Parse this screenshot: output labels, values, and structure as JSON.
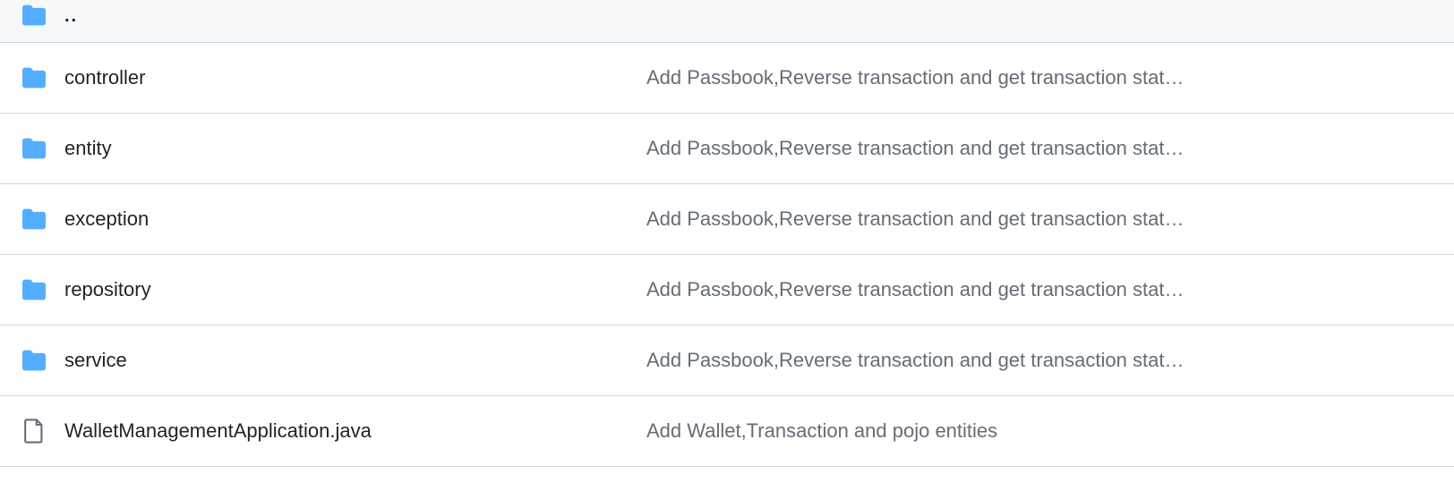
{
  "rows": [
    {
      "icon": "folder",
      "name": "..",
      "commit": "",
      "parent": true
    },
    {
      "icon": "folder",
      "name": "controller",
      "commit": "Add Passbook,Reverse transaction and get transaction stat…"
    },
    {
      "icon": "folder",
      "name": "entity",
      "commit": "Add Passbook,Reverse transaction and get transaction stat…"
    },
    {
      "icon": "folder",
      "name": "exception",
      "commit": "Add Passbook,Reverse transaction and get transaction stat…"
    },
    {
      "icon": "folder",
      "name": "repository",
      "commit": "Add Passbook,Reverse transaction and get transaction stat…"
    },
    {
      "icon": "folder",
      "name": "service",
      "commit": "Add Passbook,Reverse transaction and get transaction stat…"
    },
    {
      "icon": "file",
      "name": "WalletManagementApplication.java",
      "commit": "Add Wallet,Transaction and pojo entities"
    }
  ]
}
